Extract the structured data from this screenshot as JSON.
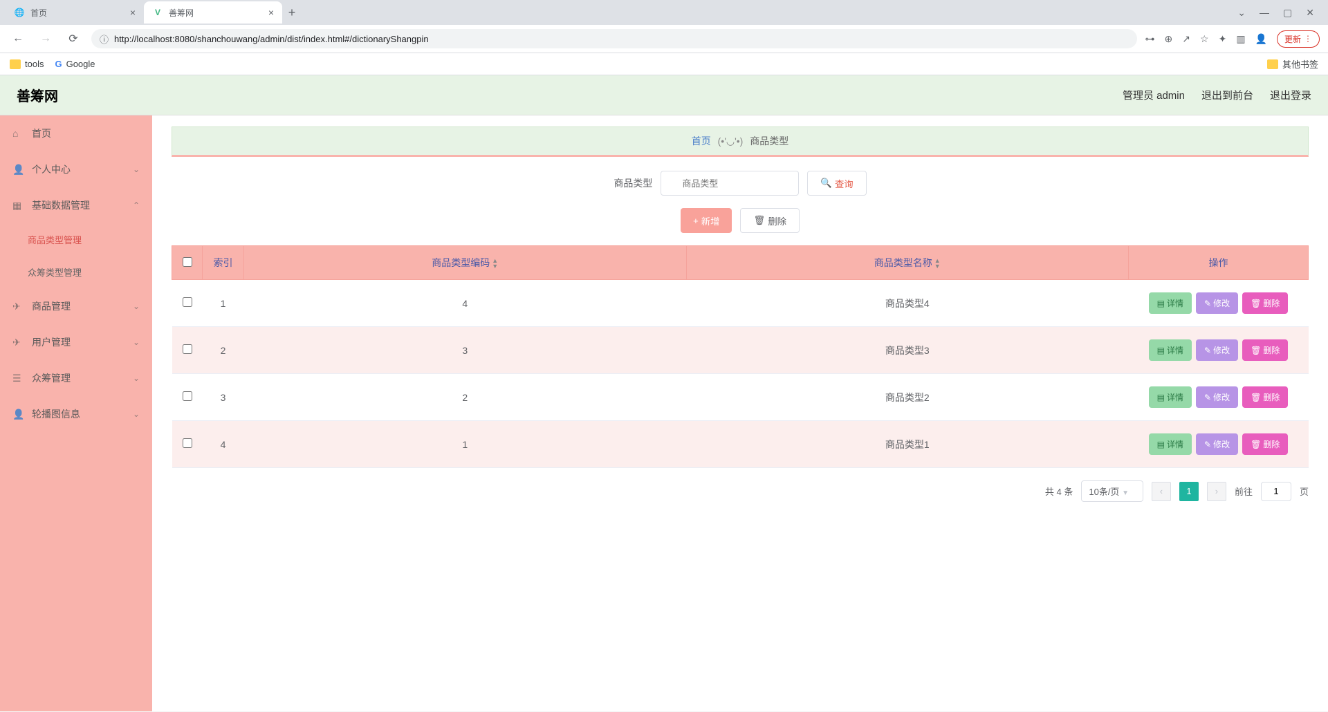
{
  "browser": {
    "tabs": [
      {
        "title": "首页",
        "active": false
      },
      {
        "title": "善筹网",
        "active": true
      }
    ],
    "url": "http://localhost:8080/shanchouwang/admin/dist/index.html#/dictionaryShangpin",
    "update_label": "更新",
    "bookmarks": {
      "tools": "tools",
      "google": "Google",
      "other": "其他书签"
    }
  },
  "header": {
    "app_title": "善筹网",
    "user_label": "管理员 admin",
    "to_front": "退出到前台",
    "logout": "退出登录"
  },
  "sidebar": {
    "home": "首页",
    "personal": "个人中心",
    "base_data": "基础数据管理",
    "sub_product_type": "商品类型管理",
    "sub_crowd_type": "众筹类型管理",
    "product": "商品管理",
    "user": "用户管理",
    "crowd": "众筹管理",
    "carousel": "轮播图信息"
  },
  "breadcrumb": {
    "home": "首页",
    "separator": "(•'◡'•)",
    "current": "商品类型"
  },
  "search": {
    "label": "商品类型",
    "placeholder": "商品类型",
    "query_btn": "查询"
  },
  "actions": {
    "add": "新增",
    "delete": "删除"
  },
  "table": {
    "col_index": "索引",
    "col_code": "商品类型编码",
    "col_name": "商品类型名称",
    "col_ops": "操作",
    "btn_detail": "详情",
    "btn_edit": "修改",
    "btn_delete": "删除",
    "rows": [
      {
        "idx": "1",
        "code": "4",
        "name": "商品类型4"
      },
      {
        "idx": "2",
        "code": "3",
        "name": "商品类型3"
      },
      {
        "idx": "3",
        "code": "2",
        "name": "商品类型2"
      },
      {
        "idx": "4",
        "code": "1",
        "name": "商品类型1"
      }
    ]
  },
  "pagination": {
    "total": "共 4 条",
    "page_size": "10条/页",
    "goto_prefix": "前往",
    "goto_value": "1",
    "goto_suffix": "页",
    "current_page": "1"
  }
}
